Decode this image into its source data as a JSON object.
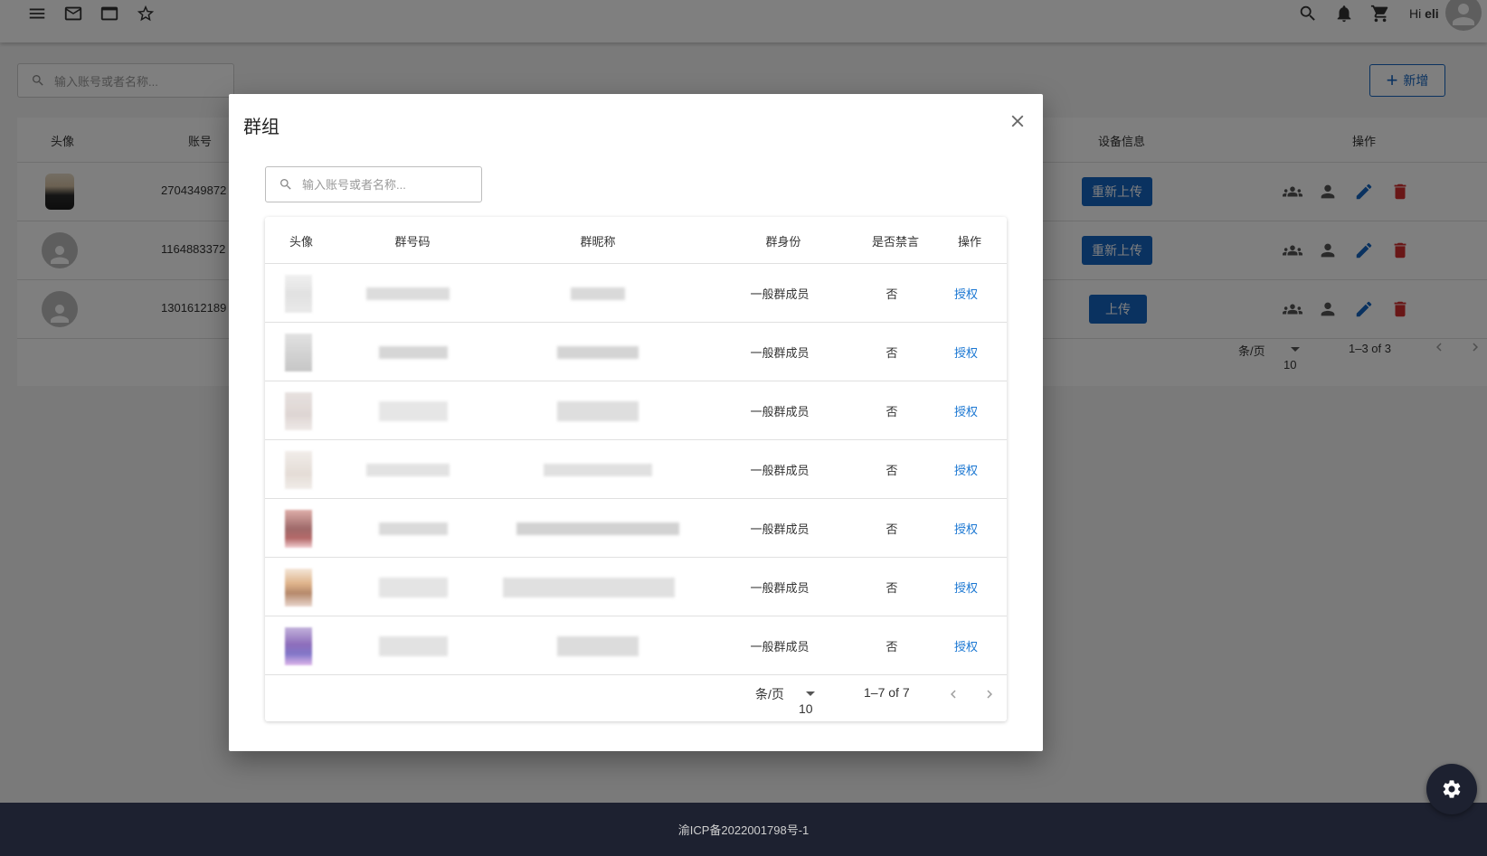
{
  "header": {
    "greeting_prefix": "Hi",
    "user_name": "eli"
  },
  "list": {
    "search_placeholder": "输入账号或者名称...",
    "add_label": "新增",
    "columns": {
      "avatar": "头像",
      "account": "账号",
      "device": "设备信息",
      "actions": "操作"
    },
    "rows": [
      {
        "account": "2704349872",
        "device_button": "重新上传"
      },
      {
        "account": "1164883372",
        "device_button": "重新上传"
      },
      {
        "account": "1301612189",
        "device_button": "上传"
      }
    ],
    "pager": {
      "per_page_label": "条/页",
      "per_page": "10",
      "range": "1–3 of 3"
    }
  },
  "dialog": {
    "title": "群组",
    "search_placeholder": "输入账号或者名称...",
    "columns": [
      "头像",
      "群号码",
      "群昵称",
      "群身份",
      "是否禁言",
      "操作"
    ],
    "rows": [
      {
        "role": "一般群成员",
        "muted": "否",
        "action": "授权"
      },
      {
        "role": "一般群成员",
        "muted": "否",
        "action": "授权"
      },
      {
        "role": "一般群成员",
        "muted": "否",
        "action": "授权"
      },
      {
        "role": "一般群成员",
        "muted": "否",
        "action": "授权"
      },
      {
        "role": "一般群成员",
        "muted": "否",
        "action": "授权"
      },
      {
        "role": "一般群成员",
        "muted": "否",
        "action": "授权"
      },
      {
        "role": "一般群成员",
        "muted": "否",
        "action": "授权"
      }
    ],
    "pager": {
      "per_page_label": "条/页",
      "per_page": "10",
      "range": "1–7 of 7"
    }
  },
  "footer": {
    "icp": "渝ICP备2022001798号-1"
  },
  "icons": [
    "menu-icon",
    "mail-icon",
    "window-icon",
    "star-icon",
    "search-icon",
    "bell-icon",
    "cart-icon",
    "group-icon",
    "person-icon",
    "edit-icon",
    "delete-icon",
    "close-icon",
    "gear-icon"
  ],
  "colors": {
    "primary": "#1565c0",
    "danger": "#d32f2f",
    "link": "#1976d2",
    "footer": "#1d2130"
  }
}
